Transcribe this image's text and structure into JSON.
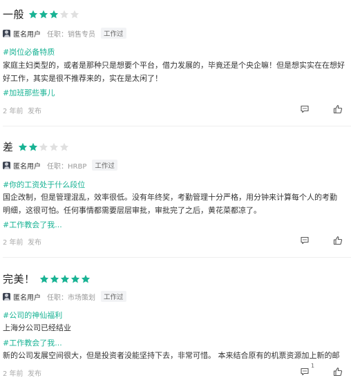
{
  "colors": {
    "accent": "#19b394",
    "star_empty": "#e0e0e0",
    "text": "#333333",
    "muted": "#999999"
  },
  "reviews": [
    {
      "title": "一般",
      "rating": 3,
      "author": "匿名用户",
      "job": "任职：销售专员",
      "badge": "工作过",
      "tag1": "#岗位必备特质",
      "line1": "家庭主妇类型的，或者是那种只是想要个平台，借力发展的，毕竟还是个央企嘛！但是想实实在在想好",
      "line2": "好工作，其实是很不推荐来的，实在是太闲了！",
      "tag2": "#加班那些事儿",
      "time": "2 年前",
      "published": "发布",
      "comment_count": ""
    },
    {
      "title": "差",
      "rating": 2,
      "author": "匿名用户",
      "job": "任职：HRBP",
      "badge": "工作过",
      "tag1": "#你的工资处于什么段位",
      "line1": "国企改制，但是管理混乱，效率很低。没有年终奖，考勤管理十分严格，用分钟来计算每个人的考勤",
      "line2": "明细，这很可怕。任何事情都需要层层审批，审批完了之后，黄花菜都凉了。",
      "tag2": "#工作教会了我...",
      "time": "2 年前",
      "published": "发布",
      "comment_count": ""
    },
    {
      "title": "完美！",
      "rating": 5,
      "author": "匿名用户",
      "job": "任职：市场策划",
      "badge": "工作过",
      "tag1": "#公司的神仙福利",
      "line1": "上海分公司已经结业",
      "tag2": "#工作教会了我...",
      "line2": "新的公司发展空间很大，但是投资者没能坚持下去，非常可惜。 本来结合原有的机票资源加上新的邮",
      "time": "2 年前",
      "published": "发布",
      "comment_count": "1"
    }
  ]
}
